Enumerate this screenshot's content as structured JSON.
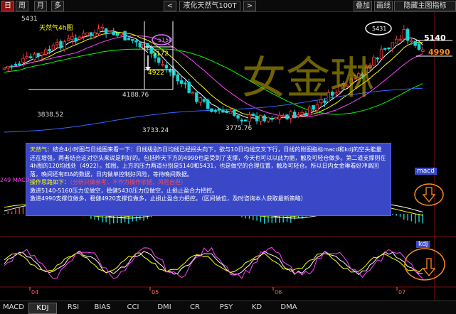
{
  "toolbar": {
    "btn_day": "日",
    "btn_week": "周",
    "btn_month": "月",
    "btn_more": "多",
    "nav_prev": "<",
    "nav_next": ">",
    "title": "液化天然气100T",
    "btn_overlay": "叠加",
    "btn_draw": "画线",
    "btn_hide_indicator": "隐藏主图指标"
  },
  "main_chart": {
    "inset_label": "天然气4h图",
    "price_labels": {
      "top_left": "5431",
      "top_right": "5431",
      "left_mid": "3838.52",
      "center_mid": "4188.76",
      "low_1": "3733.24",
      "low_2": "3775.76"
    },
    "inset_values": {
      "circle": "5150",
      "resistance": "5172",
      "support": "4922"
    },
    "right_levels": {
      "resistance": "5140",
      "support": "4990"
    },
    "watermark": "女金琳"
  },
  "annotation": {
    "line1_lead": "天然气：",
    "line1": "结合4小时图与日线图来看一下：日线级别5日均线已经拐头向下，欲与10日均线交叉下行，日线的附图指标macd和kdj的空头能量还在增强，两者结合这对空头来说是利好的。包括昨天下方的4990也是受到了支撑，今天也可以以此为据，触及可轻仓做多。第二道支撑则在4h图的120均线处（4922）。如图，上方的压力两道分别是5140和5431，也是做空的合理位置，触及可轻仓。所以日内女金琳看好冲高回落，晚间还有EIA的数据，日内做单控制好风险，等待晚间数据。",
    "line2_lead": "操作思路如下：",
    "line2": "（分析只做参考，不作为操作依据，风险自担）",
    "line3": "激进5140-5160压力位做空，稳健5430压力位做空，止损止盈合力把控。",
    "line4": "激进4990支撑位做多，稳健4920支撑位做多，止损止盈合力把控。（区间做位，及时咨询本人获取最新策略）"
  },
  "macd_panel": {
    "label": "macd",
    "left_text": "249 MACD"
  },
  "kdj_panel": {
    "label": "kdj"
  },
  "x_axis": {
    "labels": [
      "04",
      "05",
      "06",
      "07"
    ]
  },
  "indicator_tabs": [
    "MACD",
    "KDJ",
    "RSI",
    "BIAS",
    "CCI",
    "DMI",
    "CR",
    "PSY",
    "KD",
    "DMA"
  ],
  "active_tab": "KDJ",
  "colors": {
    "up": "#ff3b3b",
    "down": "#19d6d6",
    "ma5": "#ffffff",
    "ma10": "#ffff00",
    "ma20": "#ff40ff",
    "ma60": "#00ff00",
    "ma120": "#3366ff",
    "annotation_bg": "#3a48c8",
    "circle_orange": "#ff8c1a"
  }
}
